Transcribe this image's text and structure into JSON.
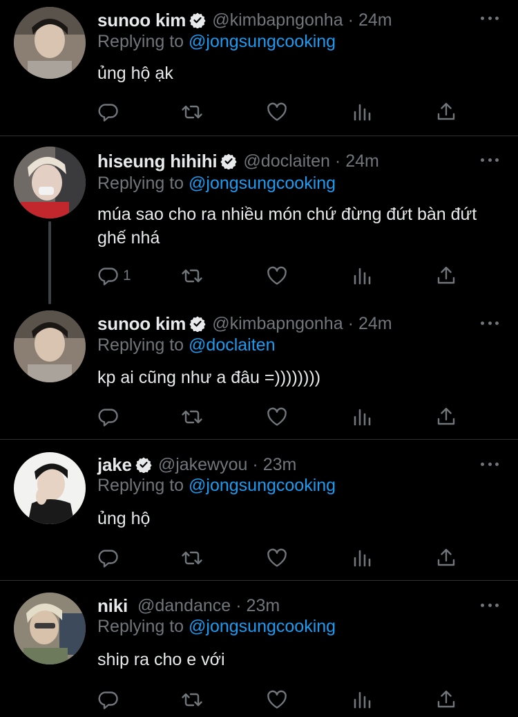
{
  "labels": {
    "replying_prefix": "Replying to"
  },
  "icons": {
    "verified": "verified-badge-icon",
    "more": "more-horizontal-icon",
    "reply": "reply-icon",
    "retweet": "retweet-icon",
    "like": "like-icon",
    "analytics": "analytics-icon",
    "share": "share-icon"
  },
  "colors": {
    "background": "#000000",
    "accent": "#1d9bf0",
    "secondary_text": "#71767b",
    "primary_text": "#e7e9ea",
    "divider": "#2f3336"
  },
  "tweets": [
    {
      "name": "sunoo kim",
      "verified": true,
      "handle": "@kimbapngonha",
      "dot": "·",
      "time": "24m",
      "replying_to": "@jongsungcooking",
      "text": "ủng hộ ạk",
      "reply_count": ""
    },
    {
      "name": "hiseung hihihi",
      "verified": true,
      "handle": "@doclaiten",
      "dot": "·",
      "time": "24m",
      "replying_to": "@jongsungcooking",
      "text": "múa sao cho ra nhiều món chứ đừng đứt bàn đứt ghế nhá",
      "reply_count": "1"
    },
    {
      "name": "sunoo kim",
      "verified": true,
      "handle": "@kimbapngonha",
      "dot": "·",
      "time": "24m",
      "replying_to": "@doclaiten",
      "text": "kp ai cũng như a đâu =))))))))",
      "reply_count": ""
    },
    {
      "name": "jake",
      "verified": true,
      "handle": "@jakewyou",
      "dot": "·",
      "time": "23m",
      "replying_to": "@jongsungcooking",
      "text": "ủng hộ",
      "reply_count": ""
    },
    {
      "name": "niki",
      "verified": false,
      "handle": "@dandance",
      "dot": "·",
      "time": "23m",
      "replying_to": "@jongsungcooking",
      "text": "ship ra cho e với",
      "reply_count": ""
    }
  ]
}
